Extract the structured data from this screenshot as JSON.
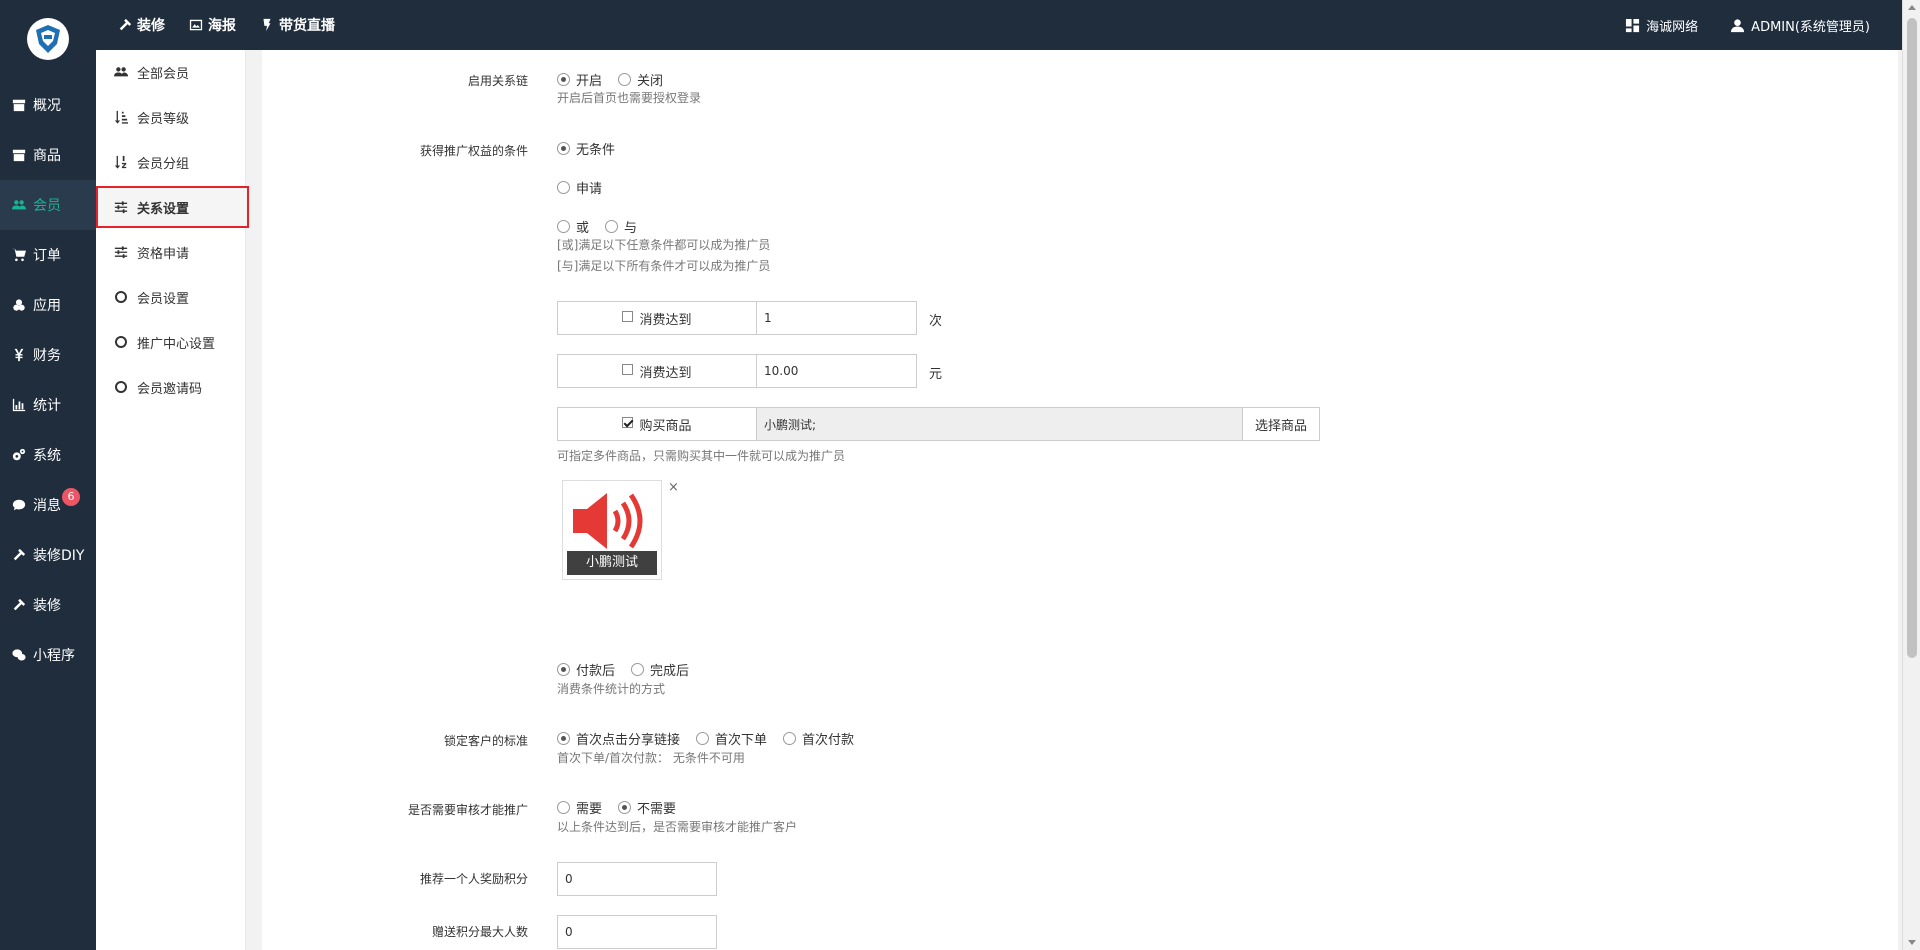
{
  "topnav": [
    {
      "label": "装修",
      "icon": "hammer-icon"
    },
    {
      "label": "海报",
      "icon": "image-icon"
    },
    {
      "label": "带货直播",
      "icon": "live-icon"
    }
  ],
  "topright": {
    "company": "海诚网络",
    "user": "ADMIN(系统管理员)"
  },
  "sidebar": {
    "items": [
      {
        "label": "概况",
        "icon": "archive-icon"
      },
      {
        "label": "商品",
        "icon": "box-icon"
      },
      {
        "label": "会员",
        "icon": "users-icon"
      },
      {
        "label": "订单",
        "icon": "cart-icon"
      },
      {
        "label": "应用",
        "icon": "cubes-icon"
      },
      {
        "label": "财务",
        "icon": "yen-icon"
      },
      {
        "label": "统计",
        "icon": "bar-chart-icon"
      },
      {
        "label": "系统",
        "icon": "gears-icon"
      },
      {
        "label": "消息",
        "icon": "chat-icon"
      },
      {
        "label": "装修DIY",
        "icon": "hammer-icon"
      },
      {
        "label": "装修",
        "icon": "hammer-icon"
      },
      {
        "label": "小程序",
        "icon": "wechat-icon"
      }
    ],
    "message_badge": "6"
  },
  "subnav": {
    "items": [
      {
        "label": "全部会员"
      },
      {
        "label": "会员等级"
      },
      {
        "label": "会员分组"
      },
      {
        "label": "关系设置"
      },
      {
        "label": "资格申请"
      },
      {
        "label": "会员设置"
      },
      {
        "label": "推广中心设置"
      },
      {
        "label": "会员邀请码"
      }
    ]
  },
  "form": {
    "relation_chain": {
      "label": "启用关系链",
      "on": "开启",
      "off": "关闭",
      "help": "开启后首页也需要授权登录"
    },
    "condition": {
      "label": "获得推广权益的条件",
      "none": "无条件",
      "apply": "申请",
      "or": "或",
      "and": "与",
      "help_or": "[或]满足以下任意条件都可以成为推广员",
      "help_and": "[与]满足以下所有条件才可以成为推广员",
      "consume_times_label": "消费达到",
      "consume_times_value": "1",
      "consume_times_unit": "次",
      "consume_amount_label": "消费达到",
      "consume_amount_value": "10.00",
      "consume_amount_unit": "元",
      "buy_goods_label": "购买商品",
      "buy_goods_value": "小鹏测试;",
      "select_goods_button": "选择商品",
      "buy_goods_help": "可指定多件商品，只需购买其中一件就可以成为推广员",
      "goods_caption": "小鹏测试",
      "goods_remove": "×"
    },
    "stat_method": {
      "after_pay": "付款后",
      "after_finish": "完成后",
      "help": "消费条件统计的方式"
    },
    "lock_standard": {
      "label": "锁定客户的标准",
      "first_click": "首次点击分享链接",
      "first_order": "首次下单",
      "first_pay": "首次付款",
      "help": "首次下单/首次付款： 无条件不可用"
    },
    "need_audit": {
      "label": "是否需要审核才能推广",
      "yes": "需要",
      "no": "不需要",
      "help": "以上条件达到后，是否需要审核才能推广客户"
    },
    "reward_points": {
      "label": "推荐一个人奖励积分",
      "value": "0"
    },
    "max_people": {
      "label": "赠送积分最大人数",
      "value": "0"
    }
  }
}
